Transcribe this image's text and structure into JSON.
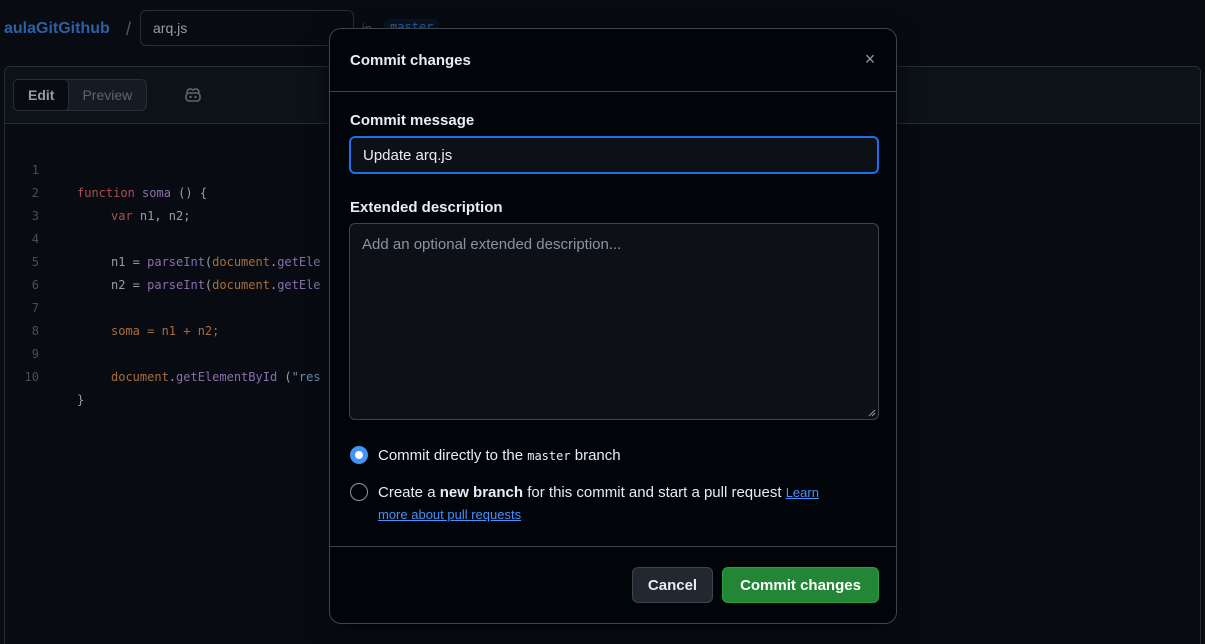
{
  "header": {
    "repo": "aulaGitGithub",
    "separator": "/",
    "filename": "arq.js",
    "in_label": "in",
    "branch": "master"
  },
  "editor": {
    "tabs": [
      {
        "label": "Edit",
        "active": true
      },
      {
        "label": "Preview",
        "active": false
      }
    ],
    "copilot_icon": "copilot-icon",
    "lines": [
      {
        "n": "1"
      },
      {
        "n": "2"
      },
      {
        "n": "3"
      },
      {
        "n": "4"
      },
      {
        "n": "5"
      },
      {
        "n": "6"
      },
      {
        "n": "7"
      },
      {
        "n": "8"
      },
      {
        "n": "9"
      },
      {
        "n": "10"
      }
    ],
    "code": {
      "l1_kw": "function",
      "l1_fn": "soma",
      "l1_rest": " () {",
      "l2_kw": "var",
      "l2_rest": " n1, n2;",
      "l4_a": "n1 = ",
      "l4_fn": "parseInt",
      "l4_b": "(",
      "l4_obj": "document",
      "l4_c": ".",
      "l4_fn2": "getEle",
      "l5_a": "n2 = ",
      "l5_fn": "parseInt",
      "l5_b": "(",
      "l5_obj": "document",
      "l5_c": ".",
      "l5_fn2": "getEle",
      "l7_a": "soma = n1 + n2;",
      "l9_obj": "document",
      "l9_c": ".",
      "l9_fn": "getElementById",
      "l9_d": " (",
      "l9_str": "\"res",
      "l10": "}"
    }
  },
  "dialog": {
    "title": "Commit changes",
    "close_icon": "×",
    "commit_message_label": "Commit message",
    "commit_message_value": "Update arq.js",
    "extended_label": "Extended description",
    "extended_placeholder": "Add an optional extended description...",
    "option_direct_prefix": "Commit directly to the ",
    "option_direct_branch": "master",
    "option_direct_suffix": " branch",
    "option_new_prefix": "Create a ",
    "option_new_bold": "new branch",
    "option_new_suffix": " for this commit and start a pull request ",
    "option_new_link": "Learn more about pull requests",
    "selected_option": "direct",
    "cancel_label": "Cancel",
    "commit_label": "Commit changes"
  },
  "colors": {
    "accent": "#4493f8",
    "primary_button": "#238636",
    "background": "#0d1117"
  }
}
